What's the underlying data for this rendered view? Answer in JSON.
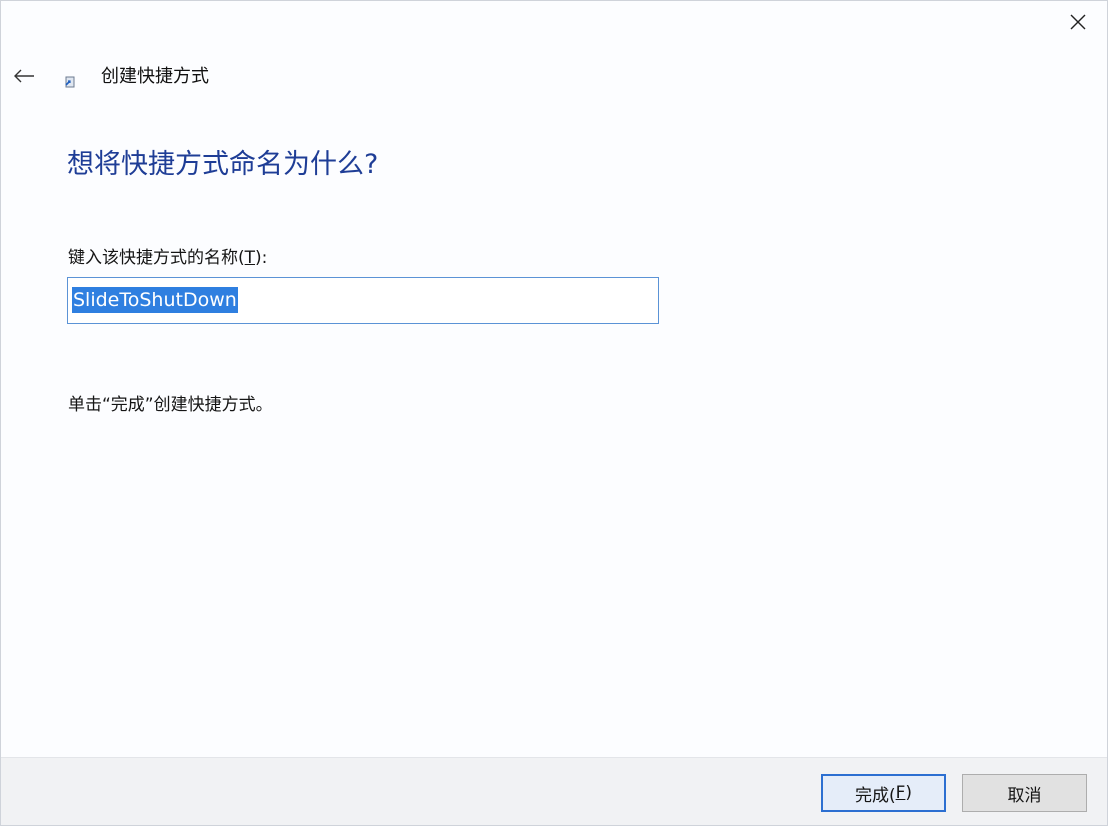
{
  "window": {
    "title": "创建快捷方式"
  },
  "page": {
    "heading": "想将快捷方式命名为什么?",
    "name_label_prefix": "键入该快捷方式的名称(",
    "name_label_accel": "T",
    "name_label_suffix": "):",
    "name_value": "SlideToShutDown",
    "instruction": "单击“完成”创建快捷方式。"
  },
  "footer": {
    "finish_prefix": "完成(",
    "finish_accel": "F",
    "finish_suffix": ")",
    "cancel_label": "取消"
  },
  "icons": {
    "back": "back-arrow-icon",
    "close": "close-icon",
    "title": "shortcut-wizard-icon"
  },
  "colors": {
    "heading": "#1e3d96",
    "selection": "#2f7fe0",
    "input_border": "#5b93d6",
    "default_button_border": "#2c6fd1",
    "footer_bg": "#f1f2f4"
  }
}
